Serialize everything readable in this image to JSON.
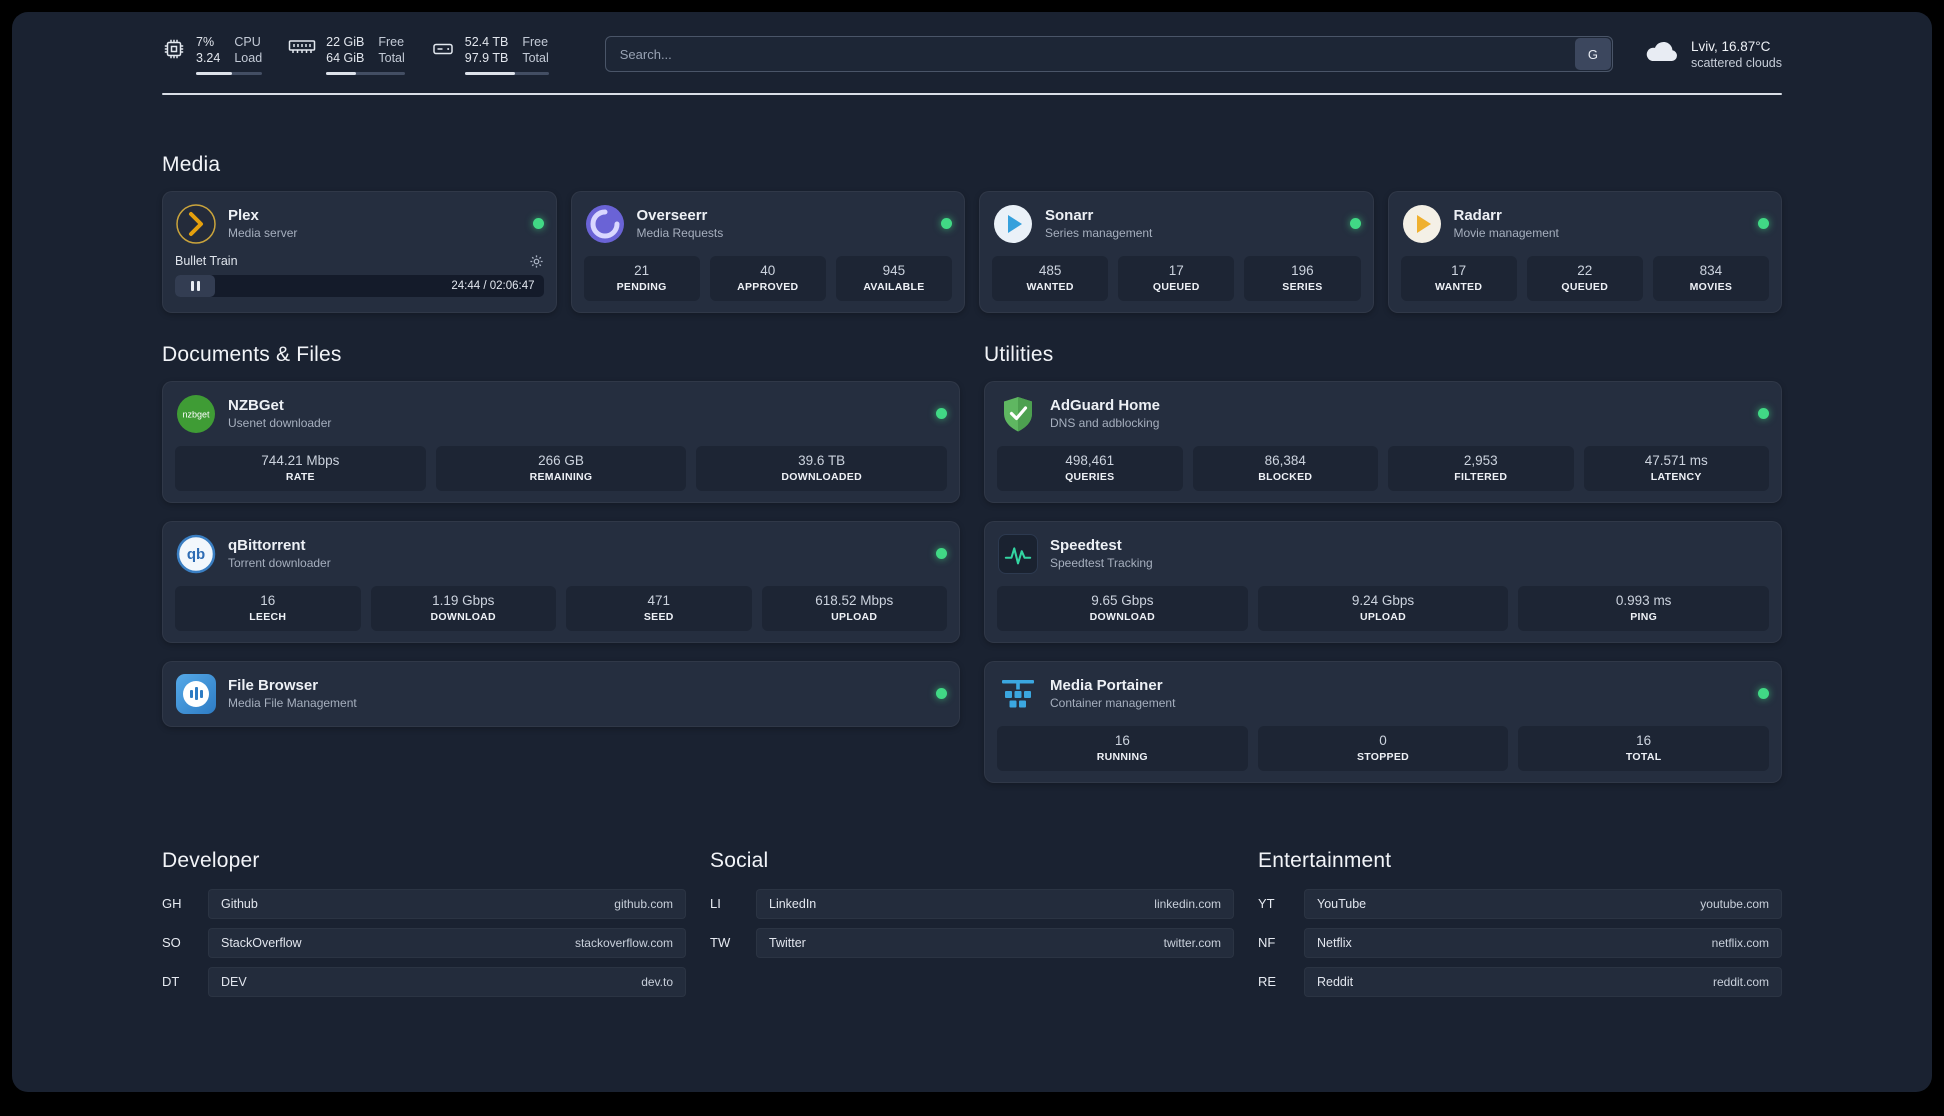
{
  "colors": {
    "status_green": "#41d985",
    "plex_amber": "#e5a00d",
    "overseerr_purple": "#6a63d6",
    "sonarr_blue": "#35a0dc",
    "radarr_yellow": "#efb02f",
    "nzbget_green": "#3f9c35",
    "qbittorrent_blue": "#2e6cb4",
    "adguard_green": "#5fb761",
    "speedtest_green": "#33d6a2",
    "portainer_blue": "#3ba7e0"
  },
  "topbar": {
    "cpu": {
      "percent": "7%",
      "load": "3.24",
      "l1": "CPU",
      "l2": "Load"
    },
    "memory": {
      "v1": "22 GiB",
      "v2": "64 GiB",
      "l1": "Free",
      "l2": "Total"
    },
    "disk": {
      "v1": "52.4 TB",
      "v2": "97.9 TB",
      "l1": "Free",
      "l2": "Total"
    },
    "search": {
      "placeholder": "Search...",
      "button": "G"
    },
    "weather": {
      "location": "Lviv, 16.87°C",
      "condition": "scattered clouds"
    }
  },
  "icons": {
    "nzbget": "nzbget",
    "qbittorrent": "qb"
  },
  "sections": {
    "media": {
      "title": "Media",
      "apps": [
        {
          "name": "Plex",
          "subtitle": "Media server",
          "player": {
            "track": "Bullet Train",
            "time": "24:44 / 02:06:47"
          }
        },
        {
          "name": "Overseerr",
          "subtitle": "Media Requests",
          "stats": [
            {
              "value": "21",
              "label": "PENDING"
            },
            {
              "value": "40",
              "label": "APPROVED"
            },
            {
              "value": "945",
              "label": "AVAILABLE"
            }
          ]
        },
        {
          "name": "Sonarr",
          "subtitle": "Series management",
          "stats": [
            {
              "value": "485",
              "label": "WANTED"
            },
            {
              "value": "17",
              "label": "QUEUED"
            },
            {
              "value": "196",
              "label": "SERIES"
            }
          ]
        },
        {
          "name": "Radarr",
          "subtitle": "Movie management",
          "stats": [
            {
              "value": "17",
              "label": "WANTED"
            },
            {
              "value": "22",
              "label": "QUEUED"
            },
            {
              "value": "834",
              "label": "MOVIES"
            }
          ]
        }
      ]
    },
    "documents": {
      "title": "Documents & Files",
      "apps": [
        {
          "name": "NZBGet",
          "subtitle": "Usenet downloader",
          "stats": [
            {
              "value": "744.21 Mbps",
              "label": "RATE"
            },
            {
              "value": "266 GB",
              "label": "REMAINING"
            },
            {
              "value": "39.6 TB",
              "label": "DOWNLOADED"
            }
          ]
        },
        {
          "name": "qBittorrent",
          "subtitle": "Torrent downloader",
          "stats": [
            {
              "value": "16",
              "label": "LEECH"
            },
            {
              "value": "1.19 Gbps",
              "label": "DOWNLOAD"
            },
            {
              "value": "471",
              "label": "SEED"
            },
            {
              "value": "618.52 Mbps",
              "label": "UPLOAD"
            }
          ]
        },
        {
          "name": "File Browser",
          "subtitle": "Media File Management"
        }
      ]
    },
    "utilities": {
      "title": "Utilities",
      "apps": [
        {
          "name": "AdGuard Home",
          "subtitle": "DNS and adblocking",
          "stats": [
            {
              "value": "498,461",
              "label": "QUERIES"
            },
            {
              "value": "86,384",
              "label": "BLOCKED"
            },
            {
              "value": "2,953",
              "label": "FILTERED"
            },
            {
              "value": "47.571 ms",
              "label": "LATENCY"
            }
          ]
        },
        {
          "name": "Speedtest",
          "subtitle": "Speedtest Tracking",
          "stats": [
            {
              "value": "9.65 Gbps",
              "label": "DOWNLOAD"
            },
            {
              "value": "9.24 Gbps",
              "label": "UPLOAD"
            },
            {
              "value": "0.993 ms",
              "label": "PING"
            }
          ]
        },
        {
          "name": "Media Portainer",
          "subtitle": "Container management",
          "stats": [
            {
              "value": "16",
              "label": "RUNNING"
            },
            {
              "value": "0",
              "label": "STOPPED"
            },
            {
              "value": "16",
              "label": "TOTAL"
            }
          ]
        }
      ]
    },
    "bookmarks": [
      {
        "title": "Developer",
        "items": [
          {
            "abbr": "GH",
            "label": "Github",
            "url": "github.com"
          },
          {
            "abbr": "SO",
            "label": "StackOverflow",
            "url": "stackoverflow.com"
          },
          {
            "abbr": "DT",
            "label": "DEV",
            "url": "dev.to"
          }
        ]
      },
      {
        "title": "Social",
        "items": [
          {
            "abbr": "LI",
            "label": "LinkedIn",
            "url": "linkedin.com"
          },
          {
            "abbr": "TW",
            "label": "Twitter",
            "url": "twitter.com"
          }
        ]
      },
      {
        "title": "Entertainment",
        "items": [
          {
            "abbr": "YT",
            "label": "YouTube",
            "url": "youtube.com"
          },
          {
            "abbr": "NF",
            "label": "Netflix",
            "url": "netflix.com"
          },
          {
            "abbr": "RE",
            "label": "Reddit",
            "url": "reddit.com"
          }
        ]
      }
    ]
  }
}
